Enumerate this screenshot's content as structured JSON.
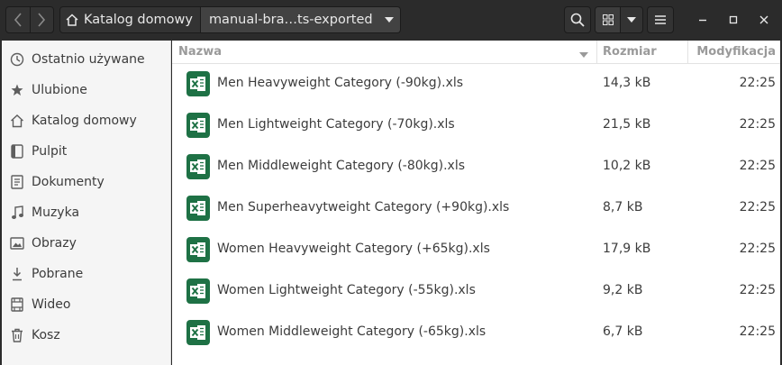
{
  "header": {
    "back_label": "❮",
    "forward_label": "❯",
    "breadcrumb_home": "Katalog domowy",
    "breadcrumb_current": "manual-bra…ts-exported",
    "search_icon": "search-icon",
    "view_icon": "grid-icon",
    "menu_icon": "hamburger-icon"
  },
  "sidebar": {
    "items": [
      {
        "label": "Ostatnio używane",
        "icon": "clock-icon"
      },
      {
        "label": "Ulubione",
        "icon": "star-icon"
      },
      {
        "label": "Katalog domowy",
        "icon": "home-icon"
      },
      {
        "label": "Pulpit",
        "icon": "desktop-icon"
      },
      {
        "label": "Dokumenty",
        "icon": "document-icon"
      },
      {
        "label": "Muzyka",
        "icon": "music-icon"
      },
      {
        "label": "Obrazy",
        "icon": "image-icon"
      },
      {
        "label": "Pobrane",
        "icon": "download-icon"
      },
      {
        "label": "Wideo",
        "icon": "video-icon"
      },
      {
        "label": "Kosz",
        "icon": "trash-icon"
      }
    ]
  },
  "list": {
    "columns": {
      "name": "Nazwa",
      "size": "Rozmiar",
      "modified": "Modyfikacja"
    },
    "files": [
      {
        "name": "Men Heavyweight Category (-90kg).xls",
        "size": "14,3 kB",
        "modified": "22:25"
      },
      {
        "name": "Men Lightweight Category (-70kg).xls",
        "size": "21,5 kB",
        "modified": "22:25"
      },
      {
        "name": "Men Middleweight Category (-80kg).xls",
        "size": "10,2 kB",
        "modified": "22:25"
      },
      {
        "name": "Men Superheavytweight Category (+90kg).xls",
        "size": "8,7 kB",
        "modified": "22:25"
      },
      {
        "name": "Women Heavyweight Category (+65kg).xls",
        "size": "17,9 kB",
        "modified": "22:25"
      },
      {
        "name": "Women Lightweight Category (-55kg).xls",
        "size": "9,2 kB",
        "modified": "22:25"
      },
      {
        "name": "Women Middleweight Category (-65kg).xls",
        "size": "6,7 kB",
        "modified": "22:25"
      }
    ]
  },
  "colors": {
    "excel_green": "#1e7145",
    "header_bg": "#2b2b2b",
    "sidebar_bg": "#f5f5f5"
  }
}
